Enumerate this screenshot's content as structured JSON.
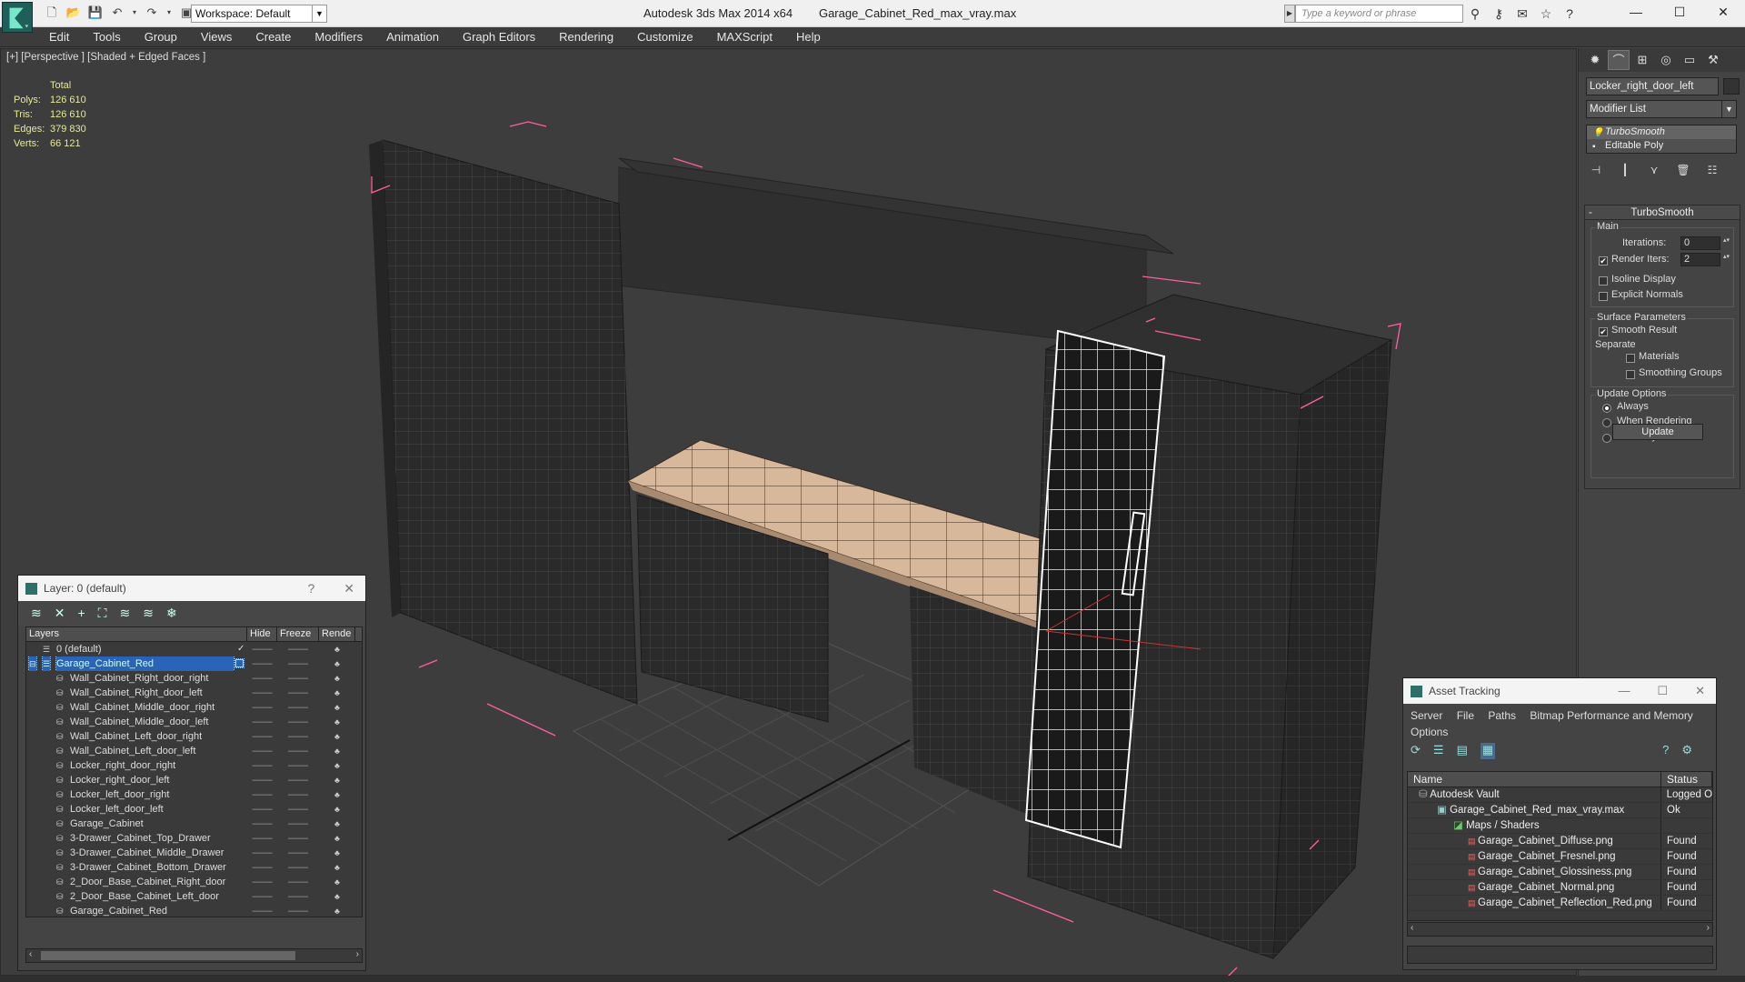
{
  "window": {
    "app_title": "Autodesk 3ds Max 2014 x64",
    "file_title": "Garage_Cabinet_Red_max_vray.max",
    "workspace": "Workspace: Default",
    "search_placeholder": "Type a keyword or phrase"
  },
  "menu": [
    "Edit",
    "Tools",
    "Group",
    "Views",
    "Create",
    "Modifiers",
    "Animation",
    "Graph Editors",
    "Rendering",
    "Customize",
    "MAXScript",
    "Help"
  ],
  "viewport": {
    "label": "[+] [Perspective ] [Shaded + Edged Faces ]",
    "stats": {
      "header": "Total",
      "polys_label": "Polys:",
      "polys": "126 610",
      "tris_label": "Tris:",
      "tris": "126 610",
      "edges_label": "Edges:",
      "edges": "379 830",
      "verts_label": "Verts:",
      "verts": "66 121"
    }
  },
  "command_panel": {
    "object_name": "Locker_right_door_left",
    "modifier_list": "Modifier List",
    "stack": [
      "TurboSmooth",
      "Editable Poly"
    ],
    "rollout_title": "TurboSmooth",
    "main_group": "Main",
    "iterations_label": "Iterations:",
    "iterations": "0",
    "render_iters_label": "Render Iters:",
    "render_iters": "2",
    "isoline": "Isoline Display",
    "explicit_normals": "Explicit Normals",
    "surface_group": "Surface Parameters",
    "smooth_result": "Smooth Result",
    "separate": "Separate",
    "materials": "Materials",
    "smoothing_groups": "Smoothing Groups",
    "update_group": "Update Options",
    "always": "Always",
    "when_rendering": "When Rendering",
    "manually": "Manually",
    "update_button": "Update"
  },
  "layer_dialog": {
    "title": "Layer: 0 (default)",
    "help": "?",
    "close": "✕",
    "columns": [
      "Layers",
      "Hide",
      "Freeze",
      "Rende"
    ],
    "layers": [
      "0 (default)",
      "Garage_Cabinet_Red",
      "Wall_Cabinet_Right_door_right",
      "Wall_Cabinet_Right_door_left",
      "Wall_Cabinet_Middle_door_right",
      "Wall_Cabinet_Middle_door_left",
      "Wall_Cabinet_Left_door_right",
      "Wall_Cabinet_Left_door_left",
      "Locker_right_door_right",
      "Locker_right_door_left",
      "Locker_left_door_right",
      "Locker_left_door_left",
      "Garage_Cabinet",
      "3-Drawer_Cabinet_Top_Drawer",
      "3-Drawer_Cabinet_Middle_Drawer",
      "3-Drawer_Cabinet_Bottom_Drawer",
      "2_Door_Base_Cabinet_Right_door",
      "2_Door_Base_Cabinet_Left_door",
      "Garage_Cabinet_Red"
    ]
  },
  "asset_tracking": {
    "title": "Asset Tracking",
    "menu": [
      "Server",
      "File",
      "Paths",
      "Bitmap Performance and Memory",
      "Options"
    ],
    "columns": [
      "Name",
      "Status"
    ],
    "rows": [
      {
        "name": "Autodesk Vault",
        "status": "Logged O"
      },
      {
        "name": "Garage_Cabinet_Red_max_vray.max",
        "status": "Ok"
      },
      {
        "name": "Maps / Shaders",
        "status": ""
      },
      {
        "name": "Garage_Cabinet_Diffuse.png",
        "status": "Found"
      },
      {
        "name": "Garage_Cabinet_Fresnel.png",
        "status": "Found"
      },
      {
        "name": "Garage_Cabinet_Glossiness.png",
        "status": "Found"
      },
      {
        "name": "Garage_Cabinet_Normal.png",
        "status": "Found"
      },
      {
        "name": "Garage_Cabinet_Reflection_Red.png",
        "status": "Found"
      }
    ]
  }
}
